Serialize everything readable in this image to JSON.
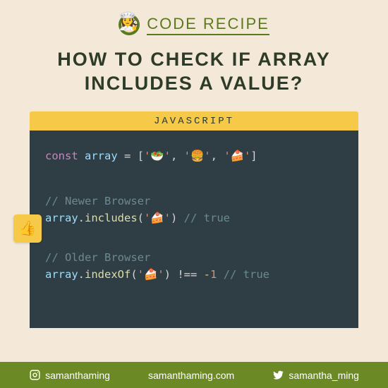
{
  "header": {
    "badge_label": "CODE RECIPE"
  },
  "title": "HOW TO CHECK IF ARRAY INCLUDES A VALUE?",
  "code": {
    "language_label": "JAVASCRIPT",
    "const_kw": "const",
    "array_ident": "array",
    "equals": " = ",
    "open_bracket": "[",
    "item1": "'🥗'",
    "sep": ", ",
    "item2": "'🍔'",
    "item3": "'🍰'",
    "close_bracket": "]",
    "comment_newer": "// Newer Browser",
    "array_ref": "array",
    "dot": ".",
    "includes_method": "includes",
    "open_paren": "(",
    "cake_arg": "'🍰'",
    "close_paren": ")",
    "comment_true": " // true",
    "comment_older": "// Older Browser",
    "indexof_method": "indexOf",
    "noteq": " !== ",
    "neg_sign": "-",
    "one": "1",
    "thumbs_icon": "👍"
  },
  "footer": {
    "instagram_handle": "samanthaming",
    "website": "samanthaming.com",
    "twitter_handle": "samantha_ming"
  }
}
